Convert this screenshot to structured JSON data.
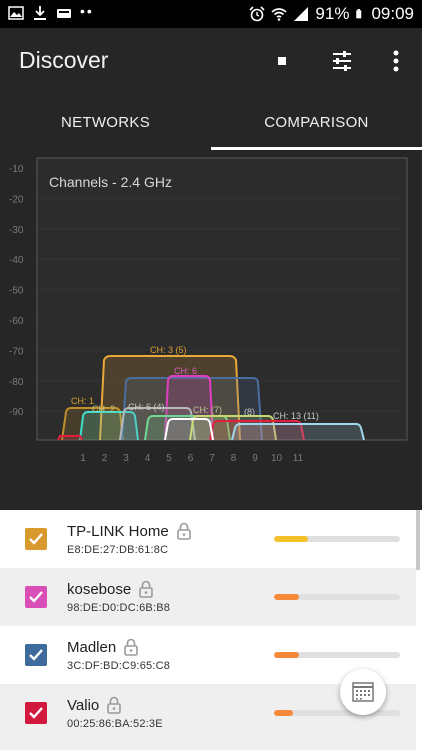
{
  "status_bar": {
    "battery": "91%",
    "time": "09:09",
    "left_icons": [
      "image-icon",
      "download-icon",
      "wear-icon",
      "more-dots"
    ],
    "right_icons": [
      "alarm-icon",
      "wifi-icon",
      "signal-icon",
      "battery-icon"
    ]
  },
  "app_bar": {
    "title": "Discover",
    "actions": [
      "stop-icon",
      "filter-icon",
      "overflow-icon"
    ]
  },
  "tabs": [
    {
      "label": "NETWORKS",
      "selected": false
    },
    {
      "label": "COMPARISON",
      "selected": true
    }
  ],
  "graph": {
    "title": "Channels - 2.4 GHz",
    "y_ticks": [
      "-10",
      "-20",
      "-30",
      "-40",
      "-50",
      "-60",
      "-70",
      "-80",
      "-90"
    ],
    "x_ticks": [
      "1",
      "2",
      "3",
      "4",
      "5",
      "6",
      "7",
      "8",
      "9",
      "10",
      "11"
    ],
    "channel_labels": [
      {
        "text": "CH: 3 (5)",
        "color": "#e0a030"
      },
      {
        "text": "CH: 6",
        "color": "#e060c0"
      },
      {
        "text": "CH: 1",
        "color": "#d4a030"
      },
      {
        "text": "CH: 2",
        "color": "#b8c890"
      },
      {
        "text": "CH: 6 (4)",
        "color": "#c8c8c8"
      },
      {
        "text": "CH: (7)",
        "color": "#b8c890"
      },
      {
        "text": "(8)",
        "color": "#c8c8c8"
      },
      {
        "text": "CH: 13 (11)",
        "color": "#c8c8c8"
      }
    ],
    "colors": {
      "orange": "#e8a83a",
      "magenta": "#e040c0",
      "blue": "#5a80b0",
      "red": "#e02040",
      "cyan": "#40e0d0",
      "light_blue": "#a0d8f0",
      "green": "#70d890",
      "yellow_green": "#c8d870"
    }
  },
  "pager": {
    "count": 5,
    "active": 1
  },
  "networks": [
    {
      "ssid": "TP-LINK Home",
      "mac": "E8:DE:27:DB:61:8C",
      "color": "#d89a2e",
      "signal": 0.27,
      "bar_color": "#f5c12a"
    },
    {
      "ssid": "kosebose",
      "mac": "98:DE:D0:DC:6B:B8",
      "color": "#d94fb7",
      "signal": 0.2,
      "bar_color": "#f5893a"
    },
    {
      "ssid": "Madlen",
      "mac": "3C:DF:BD:C9:65:C8",
      "color": "#3f6b9c",
      "signal": 0.2,
      "bar_color": "#f5893a"
    },
    {
      "ssid": "Valio",
      "mac": "00:25:86:BA:52:3E",
      "color": "#d2183c",
      "signal": 0.15,
      "bar_color": "#f5893a"
    }
  ]
}
